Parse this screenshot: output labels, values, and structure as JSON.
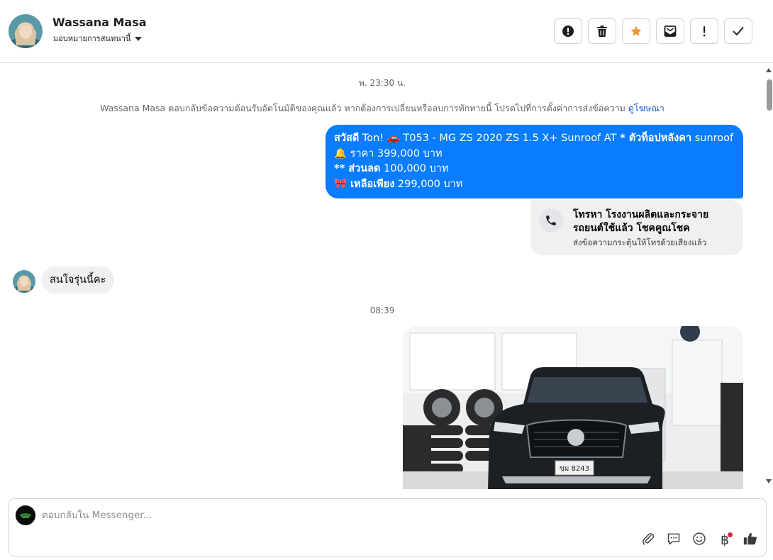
{
  "header": {
    "contact_name": "Wassana Masa",
    "assign_label": "มอบหมายการสนทนานี้",
    "actions": [
      {
        "name": "report-button",
        "icon": "alert-circle-icon"
      },
      {
        "name": "delete-button",
        "icon": "trash-icon"
      },
      {
        "name": "star-button",
        "icon": "star-icon",
        "color": "#f7923a"
      },
      {
        "name": "mark-unread-button",
        "icon": "envelope-icon"
      },
      {
        "name": "important-button",
        "icon": "exclamation-icon"
      },
      {
        "name": "done-button",
        "icon": "check-icon"
      }
    ]
  },
  "conversation": {
    "timestamp_1": "พ. 23:30 น.",
    "system_notice": "Wassana Masa ตอบกลับข้อความต้อนรับอัตโนมัติของคุณแล้ว หากต้องการเปลี่ยนหรือลบการทักทายนี้ โปรดไปที่การตั้งค่าการส่งข้อความ",
    "system_link": "ดูโฆษณา",
    "outgoing_message": {
      "line1_bold": "สวัสดี",
      "line1_text": " Ton!  🚗 T053 - MG ZS 2020 ZS 1.5 X+ Sunroof AT  ",
      "line1_bold2": "* ตัวท็อปหลังคา",
      "line1_tail": " sunroof",
      "line2": "🔔  ราคา 399,000 บาท",
      "line3_bold": "** ส่วนลด",
      "line3_text": " 100,000 บาท",
      "line4_bold": "🎀 เหลือเพียง",
      "line4_text": " 299,000 บาท"
    },
    "call_card": {
      "title": "โทรหา โรงงานผลิตและกระจายรถยนต์ใช้แล้ว โชคคูณโชค",
      "subtitle": "ส่งข้อความกระตุ้นให้โทรด้วยเสียงแล้ว"
    },
    "incoming_message": "สนใจรุ่นนี้คะ",
    "timestamp_2": "08:39",
    "plate_text": "ขม 8243"
  },
  "composer": {
    "placeholder": "ตอบกลับใน Messenger...",
    "tools": [
      "paperclip-icon",
      "saved-reply-icon",
      "emoji-icon",
      "baht-icon",
      "thumbs-up-icon"
    ],
    "baht_symbol": "฿"
  },
  "colors": {
    "accent_blue": "#0a7cff",
    "star_orange": "#f7923a",
    "link_blue": "#1a5fd0",
    "notification_red": "#e41e3f"
  }
}
